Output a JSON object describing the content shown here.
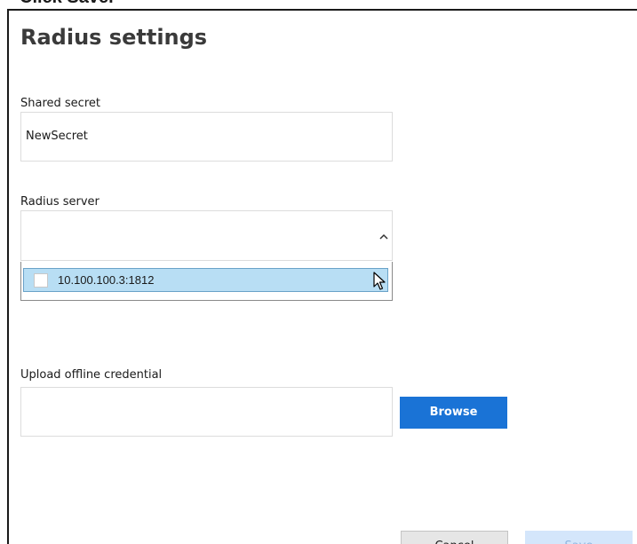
{
  "caption": "Click Save.",
  "dialog": {
    "title": "Radius settings"
  },
  "shared_secret": {
    "label": "Shared secret",
    "value": "NewSecret"
  },
  "radius_server": {
    "label": "Radius server",
    "selected_value": "",
    "expanded": true,
    "chevron_icon": "chevron-up-icon",
    "options": [
      {
        "label": "10.100.100.3:1812",
        "checked": false,
        "highlighted": true
      }
    ]
  },
  "upload_offline_credential": {
    "label": "Upload offline credential",
    "value": "",
    "browse_label": "Browse"
  },
  "buttons": {
    "cancel_label": "Cancel",
    "save_label": "Save",
    "save_enabled": false
  },
  "colors": {
    "primary_button": "#1a73d6",
    "disabled_primary_button": "#d4e6fb",
    "option_highlight": "#b8def4"
  }
}
